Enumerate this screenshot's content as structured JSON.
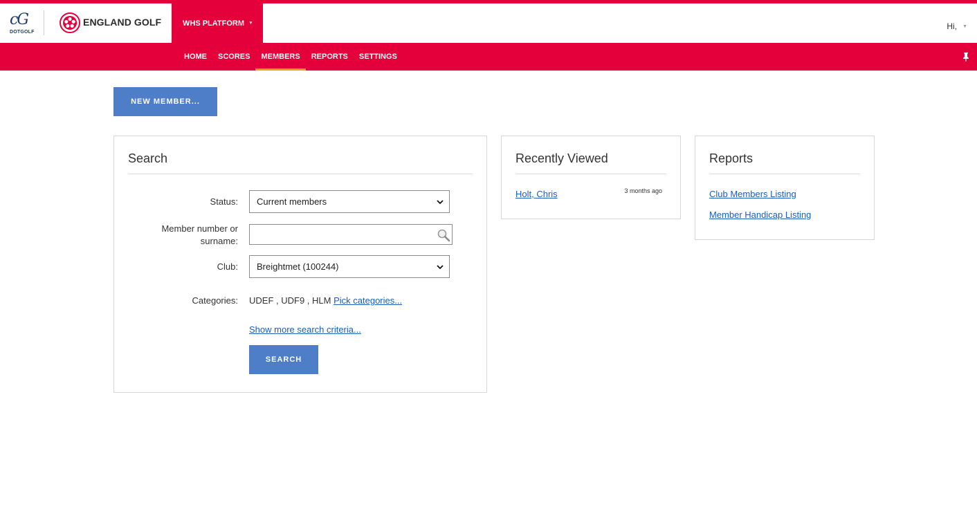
{
  "brand": {
    "dotgolf_mark": "cG",
    "dotgolf_text": "DOTGOLF",
    "england_golf": "ENGLAND GOLF"
  },
  "header": {
    "platform_label": "WHS PLATFORM",
    "user_greeting": "Hi,",
    "accent_color": "#e4003b"
  },
  "nav": {
    "items": [
      {
        "label": "HOME"
      },
      {
        "label": "SCORES"
      },
      {
        "label": "MEMBERS"
      },
      {
        "label": "REPORTS"
      },
      {
        "label": "SETTINGS"
      }
    ],
    "active": "MEMBERS",
    "active_underline_color": "#f39b1f"
  },
  "actions": {
    "new_member_label": "NEW MEMBER..."
  },
  "search": {
    "title": "Search",
    "status_label": "Status:",
    "status_value": "Current members",
    "member_label_line1": "Member number or",
    "member_label_line2": "surname:",
    "member_value": "",
    "club_label": "Club:",
    "club_value": "Breightmet (100244)",
    "categories_label": "Categories:",
    "categories_value": "UDEF , UDF9 , HLM",
    "pick_categories_link": "Pick categories...",
    "more_criteria_link": "Show more search criteria...",
    "search_button": "SEARCH",
    "button_color": "#4f7ec9"
  },
  "recent": {
    "title": "Recently Viewed",
    "items": [
      {
        "name": "Holt, Chris",
        "when": "3 months ago"
      }
    ]
  },
  "reports": {
    "title": "Reports",
    "links": [
      {
        "label": "Club Members Listing"
      },
      {
        "label": "Member Handicap Listing"
      }
    ]
  }
}
